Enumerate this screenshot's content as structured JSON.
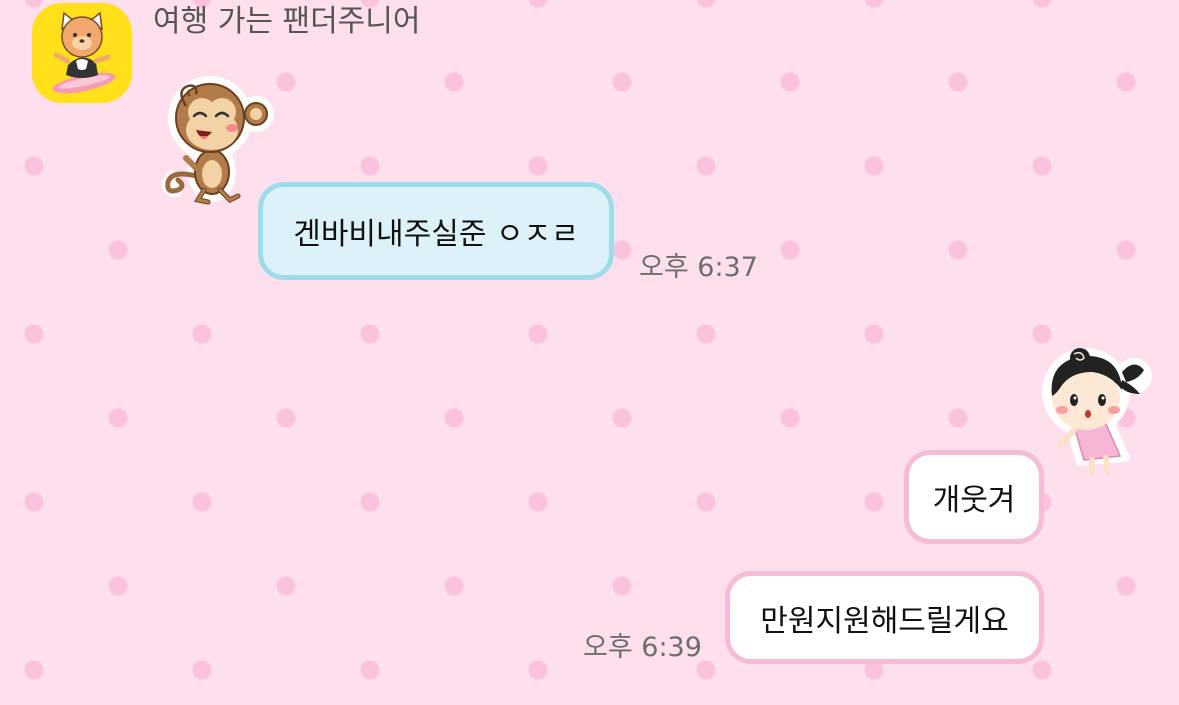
{
  "chat": {
    "sender_name": "여행 가는 팬더주니어",
    "avatar_icon": "panda-junior-surfboard-icon",
    "messages": [
      {
        "direction": "incoming",
        "sticker": "waving-monkey-sticker",
        "text": "겐바비내주실준 ㅇㅈㄹ",
        "time": "오후 6:37"
      },
      {
        "direction": "outgoing",
        "sticker": "pigtail-girl-sticker",
        "text": "개웃겨"
      },
      {
        "direction": "outgoing",
        "text": "만원지원해드릴게요",
        "time": "오후 6:39"
      }
    ]
  },
  "colors": {
    "background": "#fddfee",
    "dots": "#fbc2dd",
    "incoming_bubble": "#ddf2f8",
    "incoming_border": "#9fdcea",
    "outgoing_bubble": "#ffffff",
    "outgoing_border": "#f6bcd7",
    "avatar_bg": "#ffe01b"
  }
}
